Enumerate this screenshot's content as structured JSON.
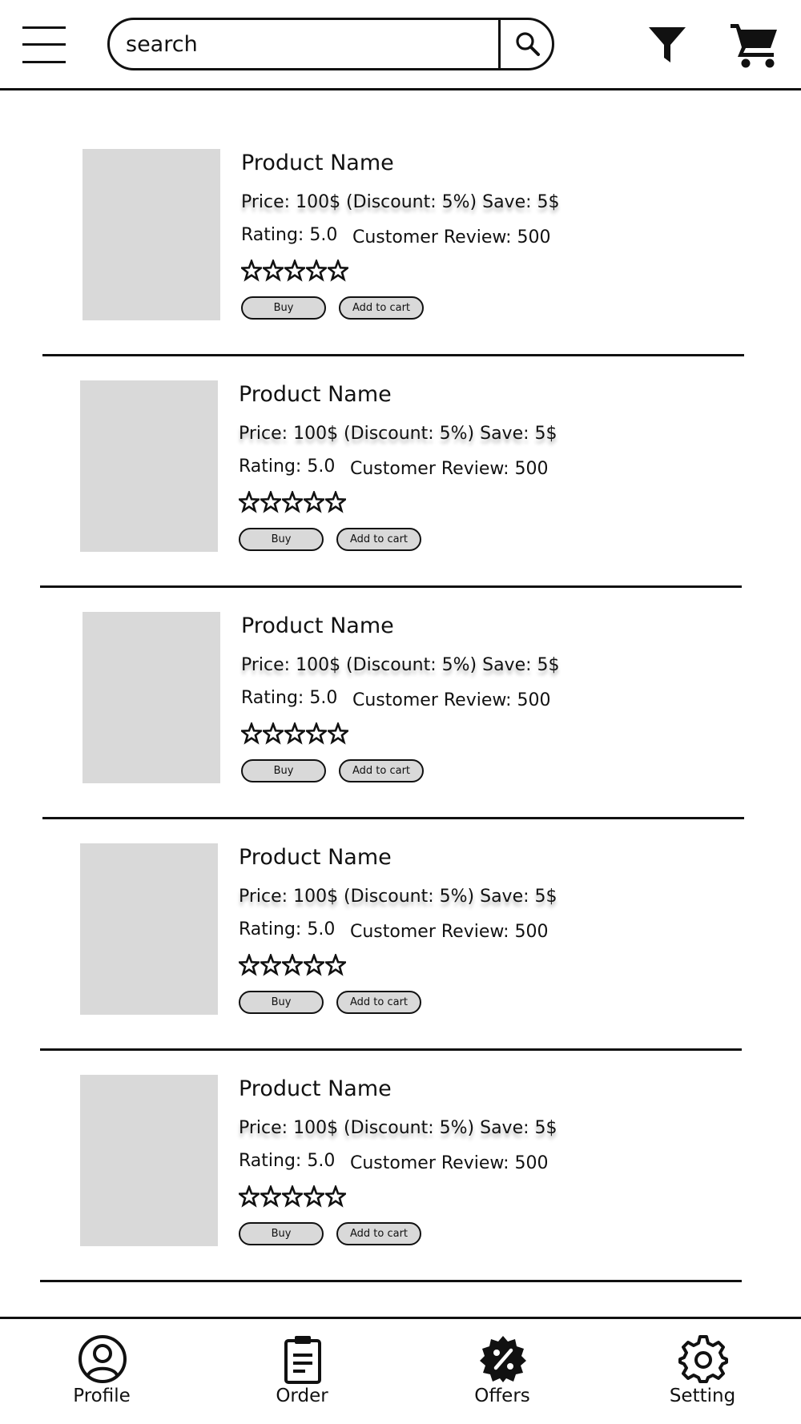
{
  "header": {
    "search": {
      "placeholder": "search",
      "value": ""
    },
    "icons": {
      "menu": "hamburger-menu-icon",
      "search": "search-icon",
      "filter": "filter-funnel-icon",
      "cart": "shopping-cart-icon"
    }
  },
  "products": [
    {
      "name": "Product Name",
      "price_line": "Price: 100$ (Discount: 5%) Save: 5$",
      "rating": "Rating: 5.0",
      "reviews": "Customer Review: 500",
      "stars": 5,
      "buy_label": "Buy",
      "add_to_cart_label": "Add to cart"
    },
    {
      "name": "Product Name",
      "price_line": "Price: 100$ (Discount: 5%) Save: 5$",
      "rating": "Rating: 5.0",
      "reviews": "Customer Review: 500",
      "stars": 5,
      "buy_label": "Buy",
      "add_to_cart_label": "Add to cart"
    },
    {
      "name": "Product Name",
      "price_line": "Price: 100$ (Discount: 5%) Save: 5$",
      "rating": "Rating: 5.0",
      "reviews": "Customer Review: 500",
      "stars": 5,
      "buy_label": "Buy",
      "add_to_cart_label": "Add to cart"
    },
    {
      "name": "Product Name",
      "price_line": "Price: 100$ (Discount: 5%) Save: 5$",
      "rating": "Rating: 5.0",
      "reviews": "Customer Review: 500",
      "stars": 5,
      "buy_label": "Buy",
      "add_to_cart_label": "Add to cart"
    },
    {
      "name": "Product Name",
      "price_line": "Price: 100$ (Discount: 5%) Save: 5$",
      "rating": "Rating: 5.0",
      "reviews": "Customer Review: 500",
      "stars": 5,
      "buy_label": "Buy",
      "add_to_cart_label": "Add to cart"
    }
  ],
  "bottom_nav": [
    {
      "label": "Profile",
      "icon": "user-circle-icon"
    },
    {
      "label": "Order",
      "icon": "clipboard-list-icon"
    },
    {
      "label": "Offers",
      "icon": "discount-badge-icon"
    },
    {
      "label": "Setting",
      "icon": "gear-icon"
    }
  ],
  "colors": {
    "image_placeholder": "#d9d9d9",
    "button_fill": "#d9d9d9",
    "ink": "#111111",
    "background": "#ffffff"
  }
}
